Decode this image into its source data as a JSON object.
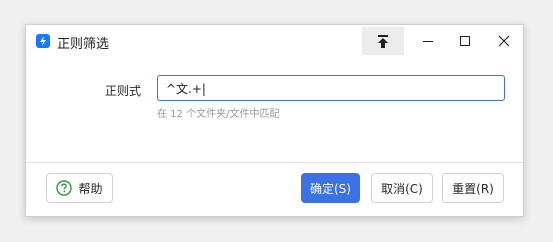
{
  "window": {
    "title": "正则筛选",
    "icons": {
      "app": "app-bolt-icon",
      "pin": "pin-top-icon",
      "minimize": "minimize-icon",
      "maximize": "maximize-icon",
      "close": "close-icon"
    }
  },
  "form": {
    "label": "正则式",
    "value": "^文.+|",
    "hint": "在 12 个文件夹/文件中匹配"
  },
  "buttons": {
    "help": "帮助",
    "ok": "确定(S)",
    "cancel": "取消(C)",
    "reset": "重置(R)"
  },
  "colors": {
    "accent": "#3b73e6",
    "app_icon": "#1677ff",
    "help_icon": "#2e9a3e"
  }
}
